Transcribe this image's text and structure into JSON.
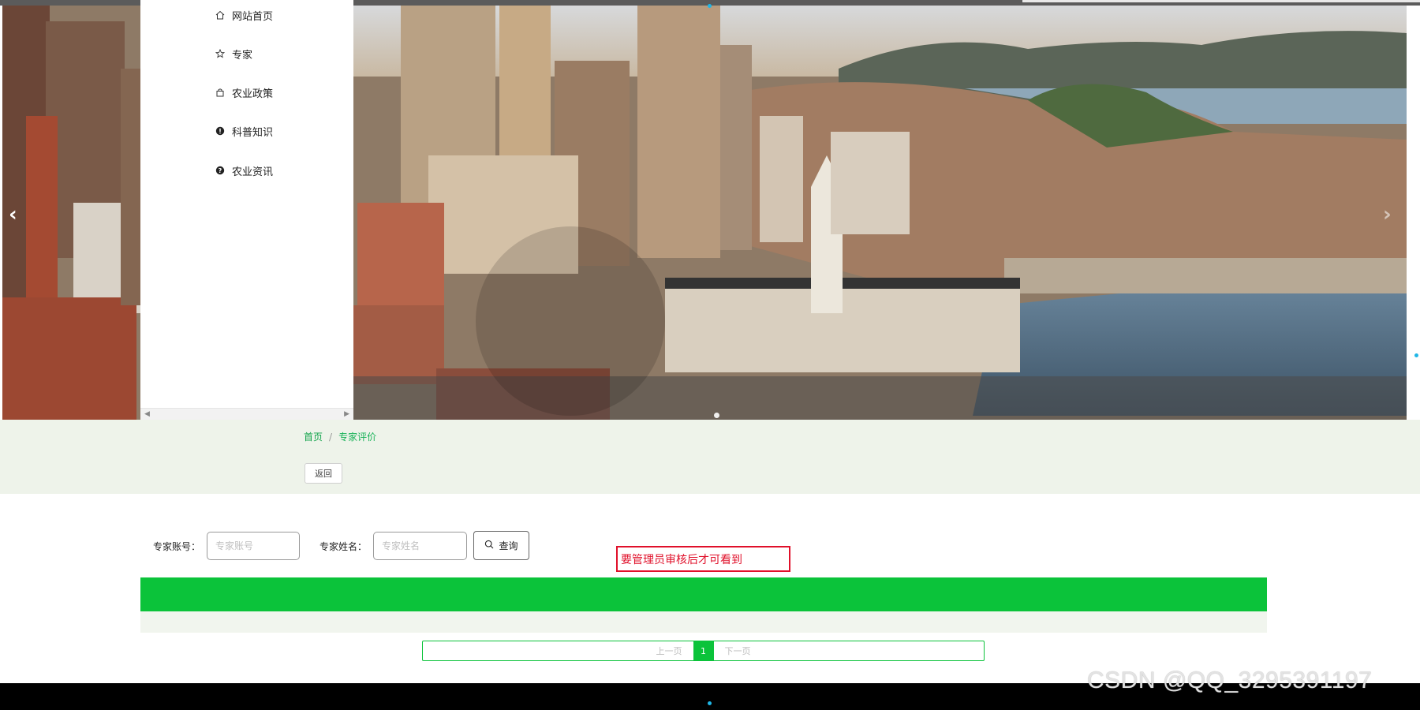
{
  "menu": {
    "items": [
      {
        "label": "网站首页",
        "icon": "home-icon"
      },
      {
        "label": "专家",
        "icon": "star-icon"
      },
      {
        "label": "农业政策",
        "icon": "bag-icon"
      },
      {
        "label": "科普知识",
        "icon": "info-circle-icon"
      },
      {
        "label": "农业资讯",
        "icon": "question-circle-icon"
      }
    ]
  },
  "breadcrumb": {
    "home": "首页",
    "separator": "/",
    "current": "专家评价"
  },
  "back_button": "返回",
  "search": {
    "account_label": "专家账号：",
    "account_placeholder": "专家账号",
    "name_label": "专家姓名：",
    "name_placeholder": "专家姓名",
    "query_label": "查询"
  },
  "annotation": "要管理员审核后才可看到",
  "pagination": {
    "prev": "上一页",
    "page": "1",
    "next": "下一页"
  },
  "watermark": "CSDN @QQ_3295391197",
  "colors": {
    "accent": "#0bc33a",
    "annotation": "#e0102a"
  }
}
